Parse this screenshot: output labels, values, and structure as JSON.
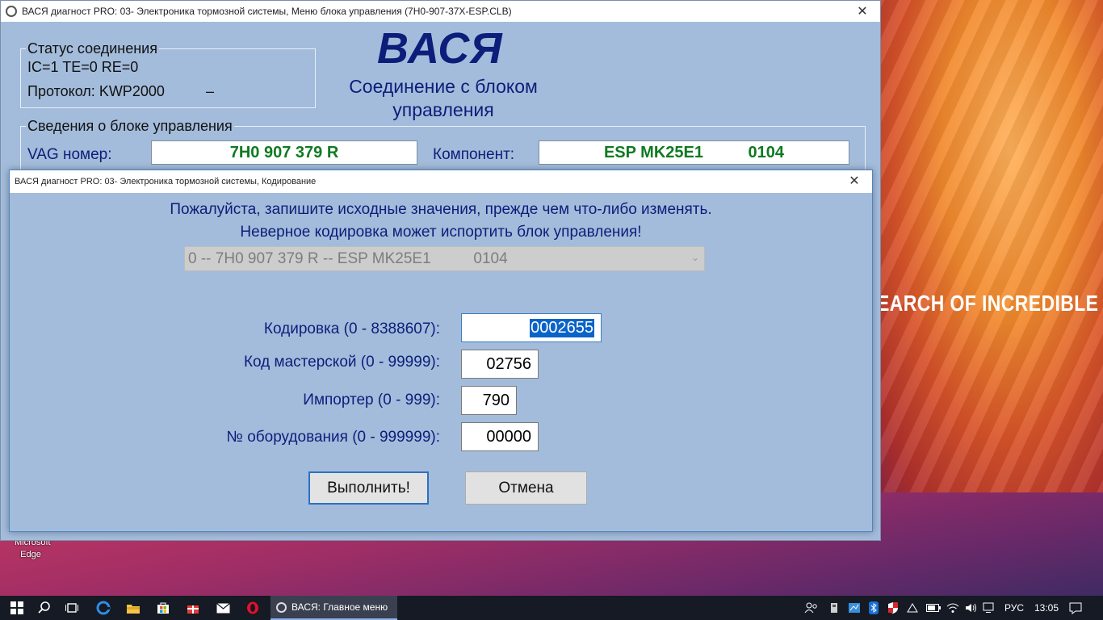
{
  "desktop": {
    "wallpaper_caption": "EARCH OF INCREDIBLE",
    "edge_icon_label_line1": "Microsoft",
    "edge_icon_label_line2": "Edge"
  },
  "main_window": {
    "title": "ВАСЯ диагност PRO: 03- Электроника тормозной системы,  Меню блока управления (7H0-907-37X-ESP.CLB)",
    "logo": "ВАСЯ",
    "connection_title": "Соединение с блоком управления",
    "status_group": {
      "legend": "Статус соединения",
      "line1": "IC=1  TE=0   RE=0",
      "protocol": "Протокол: KWP2000",
      "protocol_suffix": "–"
    },
    "info_group": {
      "legend": "Сведения о блоке управления",
      "vag_label": "VAG номер:",
      "vag_value": "7H0 907 379 R",
      "component_label": "Компонент:",
      "component_value": "ESP MK25E1          0104"
    }
  },
  "coding_dialog": {
    "title": "ВАСЯ диагност PRO: 03- Электроника тормозной системы,  Кодирование",
    "warning_line1": "Пожалуйста, запишите исходные значения, прежде чем что-либо изменять.",
    "warning_line2": "Неверное кодировка может испортить блок управления!",
    "module_select": "0 -- 7H0 907 379 R -- ESP MK25E1          0104",
    "fields": {
      "coding_label": "Кодировка (0 - 8388607):",
      "coding_value": "0002655",
      "workshop_label": "Код мастерской (0 - 99999):",
      "workshop_value": "02756",
      "importer_label": "Импортер (0 - 999):",
      "importer_value": "790",
      "equipment_label": "№ оборудования (0 - 999999):",
      "equipment_value": "00000"
    },
    "execute_label": "Выполнить!",
    "cancel_label": "Отмена"
  },
  "taskbar": {
    "app_label": "ВАСЯ:  Главное меню",
    "language": "РУС",
    "time": "13:05"
  }
}
